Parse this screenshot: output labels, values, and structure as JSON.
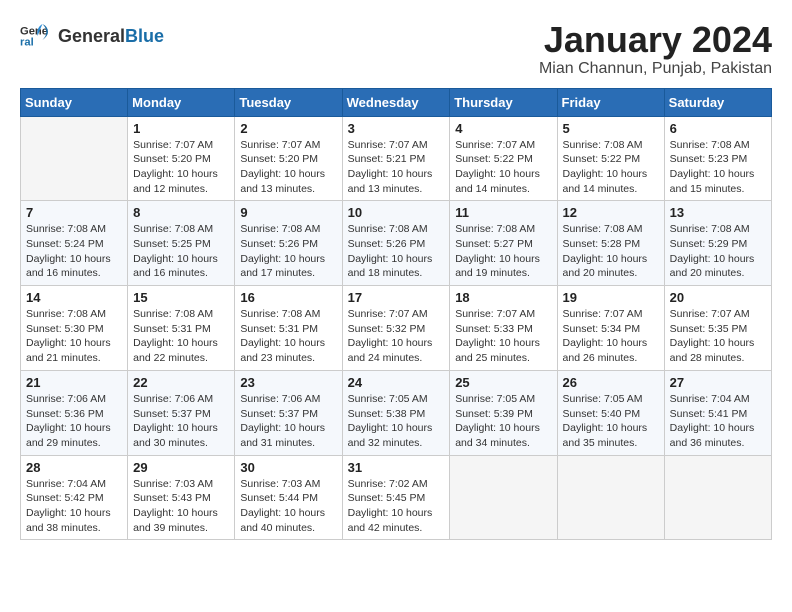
{
  "logo": {
    "general": "General",
    "blue": "Blue"
  },
  "header": {
    "month": "January 2024",
    "location": "Mian Channun, Punjab, Pakistan"
  },
  "weekdays": [
    "Sunday",
    "Monday",
    "Tuesday",
    "Wednesday",
    "Thursday",
    "Friday",
    "Saturday"
  ],
  "weeks": [
    [
      {
        "day": "",
        "empty": true
      },
      {
        "day": "1",
        "sunrise": "7:07 AM",
        "sunset": "5:20 PM",
        "daylight": "10 hours and 12 minutes."
      },
      {
        "day": "2",
        "sunrise": "7:07 AM",
        "sunset": "5:20 PM",
        "daylight": "10 hours and 13 minutes."
      },
      {
        "day": "3",
        "sunrise": "7:07 AM",
        "sunset": "5:21 PM",
        "daylight": "10 hours and 13 minutes."
      },
      {
        "day": "4",
        "sunrise": "7:07 AM",
        "sunset": "5:22 PM",
        "daylight": "10 hours and 14 minutes."
      },
      {
        "day": "5",
        "sunrise": "7:08 AM",
        "sunset": "5:22 PM",
        "daylight": "10 hours and 14 minutes."
      },
      {
        "day": "6",
        "sunrise": "7:08 AM",
        "sunset": "5:23 PM",
        "daylight": "10 hours and 15 minutes."
      }
    ],
    [
      {
        "day": "7",
        "sunrise": "7:08 AM",
        "sunset": "5:24 PM",
        "daylight": "10 hours and 16 minutes."
      },
      {
        "day": "8",
        "sunrise": "7:08 AM",
        "sunset": "5:25 PM",
        "daylight": "10 hours and 16 minutes."
      },
      {
        "day": "9",
        "sunrise": "7:08 AM",
        "sunset": "5:26 PM",
        "daylight": "10 hours and 17 minutes."
      },
      {
        "day": "10",
        "sunrise": "7:08 AM",
        "sunset": "5:26 PM",
        "daylight": "10 hours and 18 minutes."
      },
      {
        "day": "11",
        "sunrise": "7:08 AM",
        "sunset": "5:27 PM",
        "daylight": "10 hours and 19 minutes."
      },
      {
        "day": "12",
        "sunrise": "7:08 AM",
        "sunset": "5:28 PM",
        "daylight": "10 hours and 20 minutes."
      },
      {
        "day": "13",
        "sunrise": "7:08 AM",
        "sunset": "5:29 PM",
        "daylight": "10 hours and 20 minutes."
      }
    ],
    [
      {
        "day": "14",
        "sunrise": "7:08 AM",
        "sunset": "5:30 PM",
        "daylight": "10 hours and 21 minutes."
      },
      {
        "day": "15",
        "sunrise": "7:08 AM",
        "sunset": "5:31 PM",
        "daylight": "10 hours and 22 minutes."
      },
      {
        "day": "16",
        "sunrise": "7:08 AM",
        "sunset": "5:31 PM",
        "daylight": "10 hours and 23 minutes."
      },
      {
        "day": "17",
        "sunrise": "7:07 AM",
        "sunset": "5:32 PM",
        "daylight": "10 hours and 24 minutes."
      },
      {
        "day": "18",
        "sunrise": "7:07 AM",
        "sunset": "5:33 PM",
        "daylight": "10 hours and 25 minutes."
      },
      {
        "day": "19",
        "sunrise": "7:07 AM",
        "sunset": "5:34 PM",
        "daylight": "10 hours and 26 minutes."
      },
      {
        "day": "20",
        "sunrise": "7:07 AM",
        "sunset": "5:35 PM",
        "daylight": "10 hours and 28 minutes."
      }
    ],
    [
      {
        "day": "21",
        "sunrise": "7:06 AM",
        "sunset": "5:36 PM",
        "daylight": "10 hours and 29 minutes."
      },
      {
        "day": "22",
        "sunrise": "7:06 AM",
        "sunset": "5:37 PM",
        "daylight": "10 hours and 30 minutes."
      },
      {
        "day": "23",
        "sunrise": "7:06 AM",
        "sunset": "5:37 PM",
        "daylight": "10 hours and 31 minutes."
      },
      {
        "day": "24",
        "sunrise": "7:05 AM",
        "sunset": "5:38 PM",
        "daylight": "10 hours and 32 minutes."
      },
      {
        "day": "25",
        "sunrise": "7:05 AM",
        "sunset": "5:39 PM",
        "daylight": "10 hours and 34 minutes."
      },
      {
        "day": "26",
        "sunrise": "7:05 AM",
        "sunset": "5:40 PM",
        "daylight": "10 hours and 35 minutes."
      },
      {
        "day": "27",
        "sunrise": "7:04 AM",
        "sunset": "5:41 PM",
        "daylight": "10 hours and 36 minutes."
      }
    ],
    [
      {
        "day": "28",
        "sunrise": "7:04 AM",
        "sunset": "5:42 PM",
        "daylight": "10 hours and 38 minutes."
      },
      {
        "day": "29",
        "sunrise": "7:03 AM",
        "sunset": "5:43 PM",
        "daylight": "10 hours and 39 minutes."
      },
      {
        "day": "30",
        "sunrise": "7:03 AM",
        "sunset": "5:44 PM",
        "daylight": "10 hours and 40 minutes."
      },
      {
        "day": "31",
        "sunrise": "7:02 AM",
        "sunset": "5:45 PM",
        "daylight": "10 hours and 42 minutes."
      },
      {
        "day": "",
        "empty": true
      },
      {
        "day": "",
        "empty": true
      },
      {
        "day": "",
        "empty": true
      }
    ]
  ],
  "labels": {
    "sunrise": "Sunrise:",
    "sunset": "Sunset:",
    "daylight": "Daylight:"
  }
}
